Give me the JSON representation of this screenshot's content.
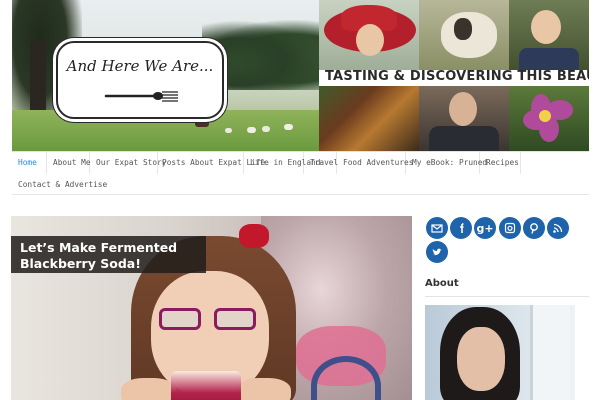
{
  "header": {
    "logo_text": "And Here We Are...",
    "tagline": "TASTING & DISCOVERING THIS BEAUTIFUL WORLD"
  },
  "nav": {
    "items": [
      {
        "label": "Home",
        "active": true
      },
      {
        "label": "About Me"
      },
      {
        "label": "Our Expat Story"
      },
      {
        "label": "Posts About Expat Life"
      },
      {
        "label": "Life in England"
      },
      {
        "label": "Travel"
      },
      {
        "label": "Food Adventures"
      },
      {
        "label": "My eBook: Pruned"
      },
      {
        "label": "Recipes"
      },
      {
        "label": "Contact & Advertise"
      }
    ]
  },
  "featured_post": {
    "title_line1": "Let’s Make Fermented",
    "title_line2": "Blackberry Soda!"
  },
  "sidebar": {
    "social": [
      {
        "icon": "email-icon"
      },
      {
        "icon": "facebook-icon"
      },
      {
        "icon": "google-plus-icon",
        "glyph": "g+"
      },
      {
        "icon": "instagram-icon"
      },
      {
        "icon": "pinterest-icon"
      },
      {
        "icon": "rss-icon"
      },
      {
        "icon": "twitter-icon"
      }
    ],
    "about_title": "About"
  },
  "colors": {
    "nav_active": "#2c8ad8",
    "social_blue": "#1f63ab",
    "title_overlay": "#221e1c"
  }
}
